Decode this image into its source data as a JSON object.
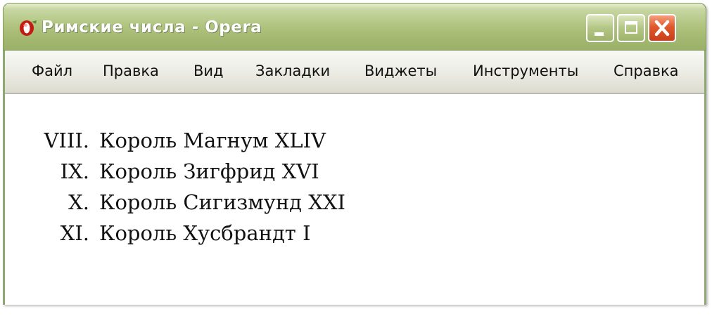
{
  "window": {
    "title": "Римские числа - Opera",
    "app_icon": "opera-icon"
  },
  "controls": {
    "minimize_icon": "minimize-icon",
    "maximize_icon": "maximize-icon",
    "close_icon": "close-icon",
    "close_color": "#e0582a"
  },
  "menu": {
    "items": [
      {
        "label": "Файл"
      },
      {
        "label": "Правка"
      },
      {
        "label": "Вид"
      },
      {
        "label": "Закладки"
      },
      {
        "label": "Виджеты"
      },
      {
        "label": "Инструменты"
      },
      {
        "label": "Справка"
      }
    ]
  },
  "content": {
    "list": [
      {
        "number": "VIII.",
        "text": "Король Магнум XLIV"
      },
      {
        "number": "IX.",
        "text": "Король Зигфрид XVI"
      },
      {
        "number": "X.",
        "text": "Король Сигизмунд XXI"
      },
      {
        "number": "XI.",
        "text": "Король Хусбрандт I"
      }
    ]
  },
  "colors": {
    "titlebar": "#b2c582",
    "frame": "#8fa872"
  }
}
